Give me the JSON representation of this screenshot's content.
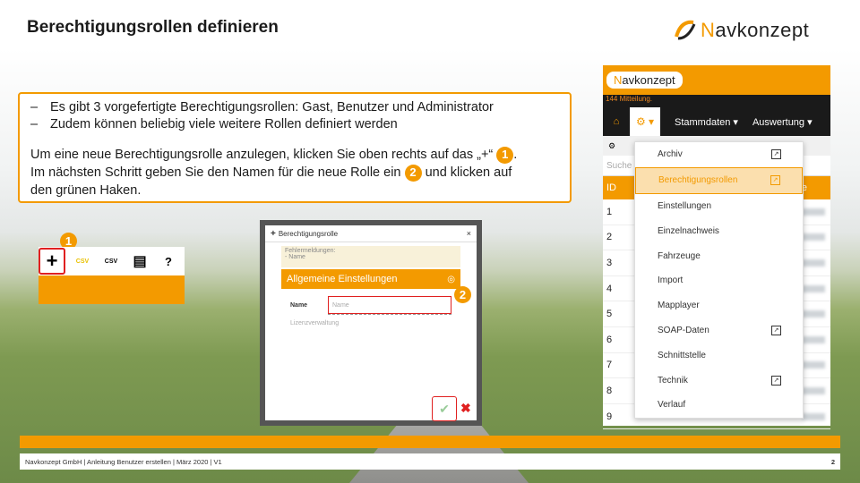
{
  "slide": {
    "title": "Berechtigungsrollen definieren",
    "logo_text_prefix": "N",
    "logo_text_rest": "avkonzept"
  },
  "info": {
    "bullets": [
      "Es gibt 3 vorgefertigte Berechtigungsrollen: Gast, Benutzer und Administrator",
      "Zudem können beliebig viele weitere Rollen definiert werden"
    ],
    "para1_a": "Um eine neue Berechtigungsrolle anzulegen, klicken Sie oben rechts auf das „+“",
    "para1_b": ".",
    "para2_a": "Im nächsten Schritt geben Sie den Namen für die neue Rolle ein",
    "para2_b": "und klicken auf",
    "para2_c": "den grünen Haken."
  },
  "badges": {
    "one": "1",
    "two": "2"
  },
  "toolbar": {
    "plus": "+",
    "csv1": "CSV",
    "csv2": "CSV",
    "print": "▤",
    "help": "?"
  },
  "dialog": {
    "title": "Berechtigungsrolle",
    "close": "×",
    "error_line1": "Fehlermeldungen:",
    "error_line2": "- Name",
    "section": "Allgemeine Einstellungen",
    "name_label": "Name",
    "name_placeholder": "Name",
    "hint": "Lizenzverwaltung",
    "ok": "✔",
    "cancel": "✖"
  },
  "app": {
    "logo_prefix": "N",
    "logo_rest": "avkonzept",
    "status": "144 Mitteilung.",
    "nav_stammdaten": "Stammdaten ▾",
    "nav_auswertung": "Auswertung ▾",
    "search_placeholder": "Suche",
    "col_id": "ID",
    "col_e": "e",
    "rows": [
      "1",
      "2",
      "3",
      "4",
      "5",
      "6",
      "7",
      "8",
      "9"
    ]
  },
  "menu": {
    "items": [
      {
        "label": "Archiv",
        "ext": true
      },
      {
        "label": "Berechtigungsrollen",
        "ext": true,
        "active": true
      },
      {
        "label": "Einstellungen",
        "ext": false
      },
      {
        "label": "Einzelnachweis",
        "ext": false
      },
      {
        "label": "Fahrzeuge",
        "ext": false
      },
      {
        "label": "Import",
        "ext": false
      },
      {
        "label": "Mapplayer",
        "ext": false
      },
      {
        "label": "SOAP-Daten",
        "ext": true
      },
      {
        "label": "Schnittstelle",
        "ext": false
      },
      {
        "label": "Technik",
        "ext": true
      },
      {
        "label": "Verlauf",
        "ext": false
      }
    ]
  },
  "footer": {
    "text": "Navkonzept GmbH | Anleitung Benutzer erstellen | März 2020 | V1",
    "page": "2"
  },
  "colors": {
    "accent": "#f39a00",
    "highlight": "#e02020"
  }
}
